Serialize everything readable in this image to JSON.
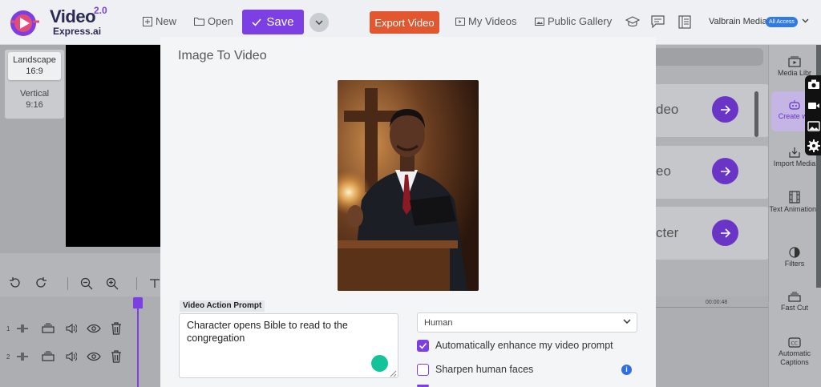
{
  "app": {
    "logo_line1": "Video",
    "logo_line2": "Express.ai",
    "logo_version": "2.0"
  },
  "toolbar": {
    "new_label": "New",
    "open_label": "Open",
    "save_label": "Save",
    "export_label": "Export Video",
    "my_videos_label": "My Videos",
    "public_gallery_label": "Public Gallery",
    "user_name": "Valbrain Media",
    "access_badge": "All Access"
  },
  "orientation": {
    "landscape_label": "Landscape",
    "landscape_ratio": "16:9",
    "vertical_label": "Vertical",
    "vertical_ratio": "9:16"
  },
  "timeline": {
    "tracks": [
      {
        "number": "1"
      },
      {
        "number": "2"
      }
    ],
    "time_marker": "00:00:48"
  },
  "panel_cards": [
    {
      "label": "deo"
    },
    {
      "label": "eo"
    },
    {
      "label": "cter"
    }
  ],
  "sidebar": {
    "items": [
      {
        "label": "Media Libr",
        "icon": "media-library-icon"
      },
      {
        "label": "Create wit",
        "icon": "robot-icon"
      },
      {
        "label": "Import Media",
        "icon": "import-icon"
      },
      {
        "label": "Text Animations",
        "icon": "film-icon"
      },
      {
        "label": "Filters",
        "icon": "filters-icon"
      },
      {
        "label": "Fast Cut",
        "icon": "fast-cut-icon"
      },
      {
        "label": "Automatic Captions",
        "icon": "captions-icon"
      }
    ]
  },
  "modal": {
    "title": "Image To Video",
    "prompt_label": "Video Action Prompt",
    "prompt_value": "Character opens Bible to read to the congregation",
    "select_value": "Human",
    "enhance_label": "Automatically enhance my video prompt",
    "enhance_checked": true,
    "sharpen_label": "Sharpen human faces",
    "sharpen_checked": false
  },
  "colors": {
    "accent": "#7b3fe4",
    "export": "#e2572f",
    "badge": "#2f7ae5"
  }
}
